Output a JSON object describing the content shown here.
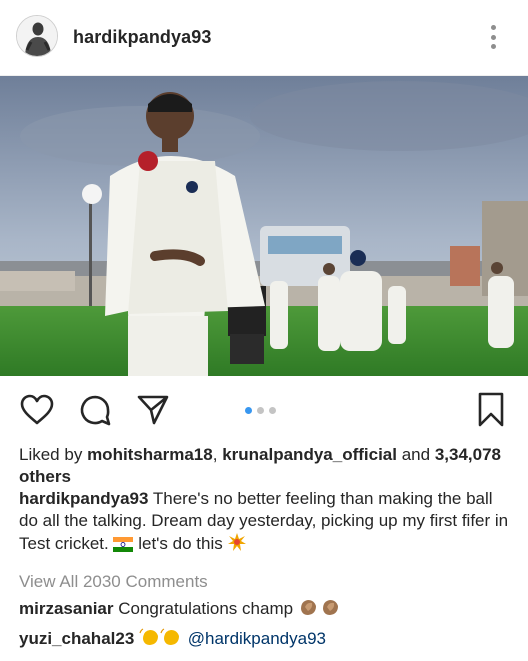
{
  "post": {
    "username": "hardikpandya93",
    "liked_by_prefix": "Liked by",
    "liker_1": "mohitsharma18",
    "separator": ",",
    "liker_2": "krunalpandya_official",
    "and_word": "and",
    "others_count": "3,34,078",
    "others_word": "others",
    "caption_user": "hardikpandya93",
    "caption_text": "There's no better feeling than making the ball do all the talking. Dream day yesterday, picking up my first fifer in Test cricket.",
    "caption_text_2": "let's do this",
    "view_all_comments": "View All 2030 Comments",
    "carousel": {
      "count": 3,
      "active_index": 0
    }
  },
  "comments": [
    {
      "user": "mirzasaniar",
      "text": "Congratulations champ"
    },
    {
      "user": "yuzi_chahal23",
      "text": "@hardikpandya93"
    }
  ],
  "icons": {
    "like": "heart-icon",
    "comment": "comment-bubble-icon",
    "share": "paper-plane-icon",
    "save": "bookmark-icon",
    "more": "more-options-icon",
    "flag": "india-flag-emoji",
    "boom": "collision-emoji",
    "clap": "clapping-hands-emoji",
    "wave": "waving-hands-emoji"
  },
  "colors": {
    "text": "#262626",
    "muted": "#8e8e8e",
    "accent_dot": "#3897f0",
    "mention": "#003569"
  }
}
